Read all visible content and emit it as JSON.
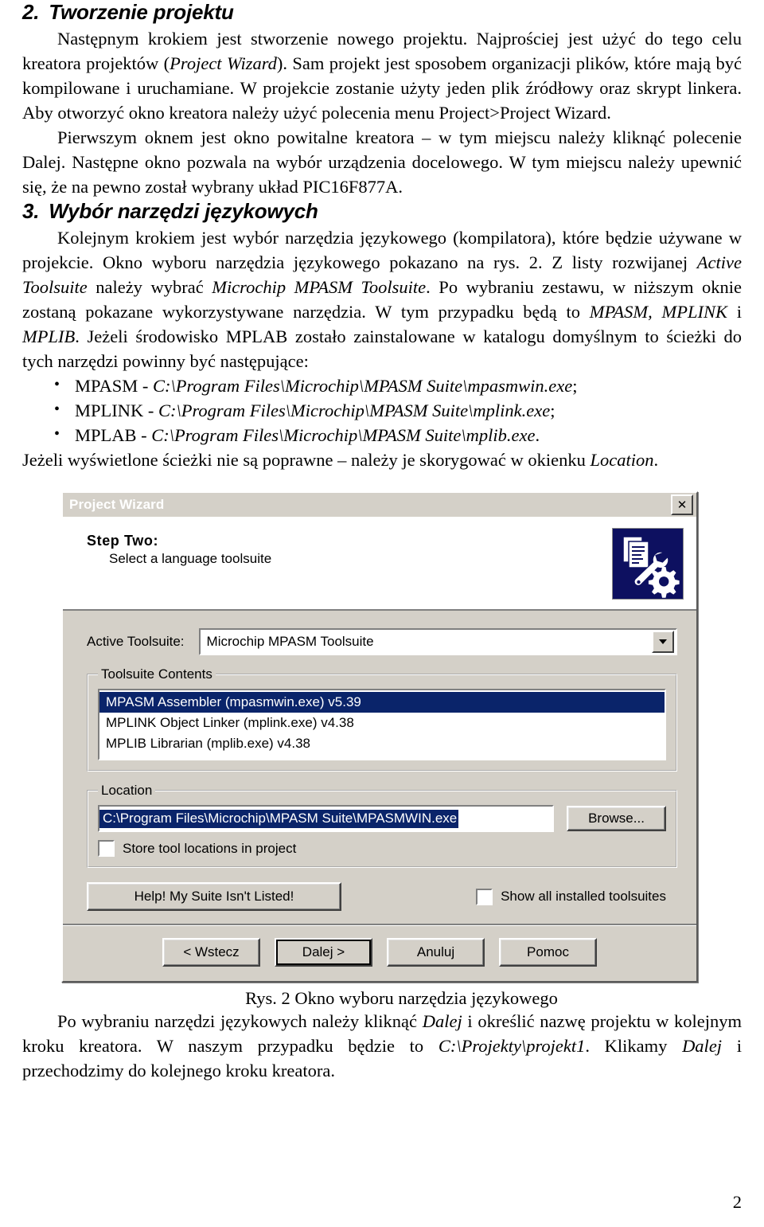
{
  "document": {
    "page_number": "2"
  },
  "section_creating_project": {
    "number": "2.",
    "heading": "Tworzenie projektu",
    "p1_a": "Następnym krokiem jest stworzenie nowego projektu. Najprościej jest użyć do tego celu kreatora projektów (",
    "p1_italic_1": "Project Wizard",
    "p1_b": "). Sam projekt jest sposobem organizacji plików, które mają być kompilowane i uruchamiane. W projekcie zostanie użyty jeden plik źródłowy oraz skrypt linkera. Aby otworzyć okno kreatora należy użyć polecenia menu Project>Project Wizard.",
    "p2": "Pierwszym oknem jest okno powitalne kreatora – w tym miejscu należy kliknąć polecenie Dalej. Następne okno pozwala na wybór urządzenia docelowego. W tym miejscu należy upewnić się, że na pewno został wybrany układ PIC16F877A."
  },
  "section_language_tools": {
    "number": "3.",
    "heading": "Wybór narzędzi językowych",
    "p1_a": "Kolejnym krokiem jest wybór narzędzia językowego (kompilatora), które będzie używane w projekcie. Okno wyboru narzędzia językowego pokazano na rys. 2. Z listy rozwijanej ",
    "p1_italic_1": "Active Toolsuite",
    "p1_b": " należy wybrać ",
    "p1_italic_2": "Microchip MPASM Toolsuite",
    "p1_c": ". Po wybraniu zestawu, w niższym oknie zostaną pokazane wykorzystywane narzędzia. W tym przypadku będą to ",
    "p1_italic_3": "MPASM, MPLINK",
    "p1_d": " i ",
    "p1_italic_4": "MPLIB",
    "p1_e": ". Jeżeli środowisko MPLAB zostało zainstalowane w katalogu domyślnym to ścieżki do tych narzędzi powinny być następujące:",
    "paths": [
      {
        "name": "MPASM - ",
        "path": "C:\\Program Files\\Microchip\\MPASM Suite\\mpasmwin.exe",
        "suffix": ";"
      },
      {
        "name": "MPLINK - ",
        "path": "C:\\Program Files\\Microchip\\MPASM Suite\\mplink.exe",
        "suffix": ";"
      },
      {
        "name": "MPLAB - ",
        "path": "C:\\Program Files\\Microchip\\MPASM Suite\\mplib.exe",
        "suffix": "."
      }
    ],
    "p_after_list_a": "Jeżeli wyświetlone ścieżki nie są poprawne – należy je skorygować w okienku ",
    "p_after_list_italic": "Location",
    "p_after_list_b": "."
  },
  "figure": {
    "caption": "Rys. 2 Okno wyboru narzędzia językowego"
  },
  "dialog": {
    "title": "Project Wizard",
    "close_label": "✕",
    "close_icon_name": "close-icon",
    "step_title": "Step Two:",
    "step_subtitle": "Select a language toolsuite",
    "icon_name": "wizard-tools-icon",
    "active_toolsuite_label": "Active Toolsuite:",
    "active_toolsuite_value": "Microchip MPASM Toolsuite",
    "toolsuite_contents_legend": "Toolsuite Contents",
    "toolsuite_items": [
      {
        "text": "MPASM Assembler (mpasmwin.exe) v5.39",
        "selected": true
      },
      {
        "text": "MPLINK Object Linker (mplink.exe) v4.38",
        "selected": false
      },
      {
        "text": "MPLIB Librarian (mplib.exe) v4.38",
        "selected": false
      }
    ],
    "location_legend": "Location",
    "location_value": "C:\\Program Files\\Microchip\\MPASM Suite\\MPASMWIN.exe",
    "browse_label": "Browse...",
    "store_checkbox_label": "Store tool locations in project",
    "store_checkbox_checked": false,
    "help_button_label": "Help!  My Suite Isn't Listed!",
    "show_all_checkbox_label": "Show all installed toolsuites",
    "show_all_checkbox_checked": false,
    "buttons": {
      "back": "< Wstecz",
      "next": "Dalej >",
      "cancel": "Anuluj",
      "help": "Pomoc"
    },
    "colors": {
      "titlebar_start": "#0a246a",
      "titlebar_end": "#bcd4f0",
      "face": "#d4d0c8",
      "selection": "#0a246a",
      "icon_background": "#0d1060"
    }
  },
  "closing_paragraph": {
    "a": "Po wybraniu narzędzi językowych należy kliknąć ",
    "italic_1": "Dalej",
    "b": " i określić nazwę projektu w kolejnym kroku kreatora. W naszym przypadku będzie to ",
    "italic_2": "C:\\Projekty\\projekt1",
    "c": ". Klikamy ",
    "italic_3": "Dalej",
    "d": " i przechodzimy do kolejnego kroku kreatora."
  }
}
